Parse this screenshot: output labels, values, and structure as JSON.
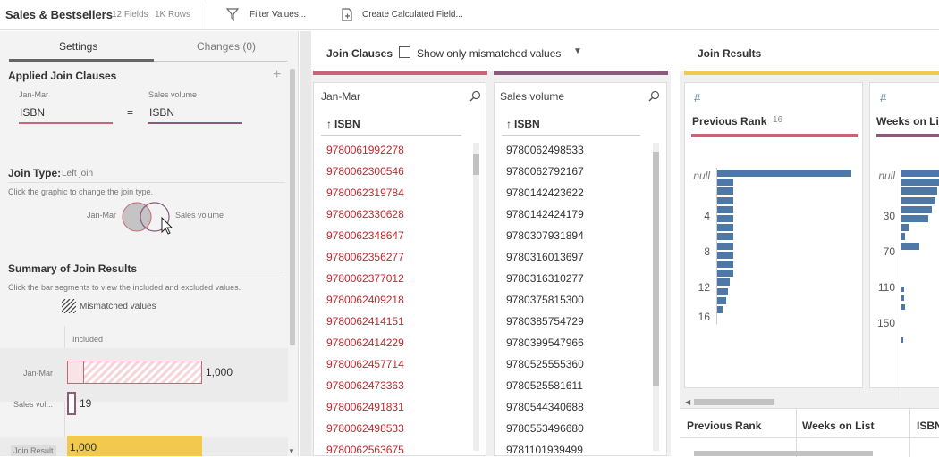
{
  "header": {
    "title": "Sales & Bestsellers",
    "fields": "12 Fields",
    "rows": "1K Rows",
    "filter": "Filter Values...",
    "calc": "Create Calculated Field..."
  },
  "left": {
    "tabs": [
      "Settings",
      "Changes (0)"
    ],
    "applied_title": "Applied Join Clauses",
    "left_table": "Jan-Mar",
    "right_table": "Sales volume",
    "left_field": "ISBN",
    "op": "=",
    "right_field": "ISBN",
    "join_type_label": "Join Type:",
    "join_type_value": "Left join",
    "join_hint": "Click the graphic to change the join type.",
    "venn_left": "Jan-Mar",
    "venn_right": "Sales volume",
    "summary_title": "Summary of Join Results",
    "summary_hint": "Click the bar segments to view the included and excluded values.",
    "mismatched_legend": "Mismatched values",
    "included": "Included",
    "rows": [
      {
        "label": "Jan-Mar",
        "value": "1,000"
      },
      {
        "label": "Sales vol...",
        "value": "19"
      },
      {
        "label": "Join Result",
        "value": "1,000"
      }
    ]
  },
  "mid": {
    "title": "Join Clauses",
    "checkbox": "Show only mismatched values",
    "left_col": {
      "table": "Jan-Mar",
      "field": "ISBN",
      "values": [
        "9780061992278",
        "9780062300546",
        "9780062319784",
        "9780062330628",
        "9780062348647",
        "9780062356277",
        "9780062377012",
        "9780062409218",
        "9780062414151",
        "9780062414229",
        "9780062457714",
        "9780062473363",
        "9780062491831",
        "9780062498533",
        "9780062563675"
      ]
    },
    "right_col": {
      "table": "Sales volume",
      "field": "ISBN",
      "values": [
        "9780062498533",
        "9780062792167",
        "9780142423622",
        "9780142424179",
        "9780307931894",
        "9780316013697",
        "9780316310277",
        "9780375815300",
        "9780385754729",
        "9780399547966",
        "9780525555360",
        "9780525581611",
        "9780544340688",
        "9780553496680",
        "9781101939499"
      ]
    }
  },
  "right": {
    "title": "Join Results",
    "card1": {
      "type_icon": "#",
      "name": "Previous Rank",
      "count": "16",
      "ticks": [
        "null",
        "4",
        "8",
        "12",
        "16"
      ]
    },
    "card2": {
      "type_icon": "#",
      "name": "Weeks on List",
      "ticks": [
        "null",
        "30",
        "70",
        "110",
        "150"
      ]
    },
    "grid_headers": [
      "Previous Rank",
      "Weeks on List",
      "ISBN"
    ]
  },
  "colors": {
    "left_accent": "#c9647a",
    "right_accent": "#8a5a7a",
    "result_accent": "#f2c94c",
    "mismatch_text": "#c1272d",
    "bar": "#4e79a7"
  }
}
